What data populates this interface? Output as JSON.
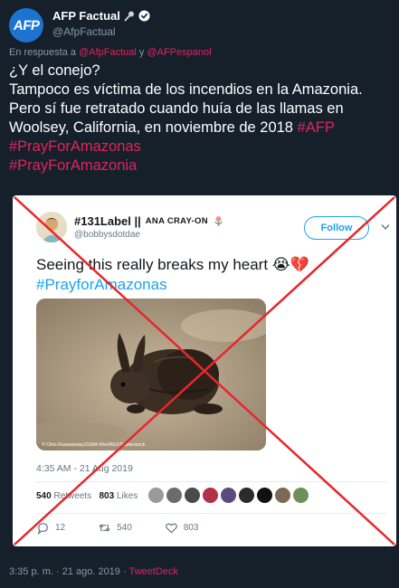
{
  "tweet": {
    "author": {
      "display_name": "AFP Factual",
      "handle": "@AfpFactual",
      "avatar_text": "AFP",
      "avatar_color": "#1d74d0",
      "badges": [
        "microphone-icon",
        "verified-icon"
      ]
    },
    "reply": {
      "prefix": "En respuesta a",
      "mention1": "@AfpFactual",
      "joiner": "y",
      "mention2": "@AFPespanol"
    },
    "text_line1": "¿Y el conejo?",
    "text_line2": "Tampoco es víctima de los incendios en la Amazonia. Pero sí fue retratado cuando huía de las llamas en Woolsey, California, en noviembre de 2018",
    "tag_afp": "#AFP",
    "tag_pray_amazonas": "#PrayForAmazonas",
    "tag_pray_amazonia": "#PrayForAmazonia",
    "footer": {
      "time": "3:35 p. m. · 21 ago. 2019 · ",
      "via": "TweetDeck"
    }
  },
  "embedded": {
    "name": "#131Label ||",
    "name_suffix": "ANA CRAY-ON",
    "handle": "@bobbysdotdae",
    "follow_label": "Follow",
    "text": "Seeing this really breaks my heart",
    "emoji_cry": "😭",
    "emoji_heart": "💔",
    "hashtag": "#PrayforAmazonas",
    "photo_credit": "© Chris Rusanowsky/ZUMA Wire/REX/Shutterstock",
    "timestamp": "4:35 AM - 21 Aug 2019",
    "retweets_count": "540",
    "retweets_label": "Retweets",
    "likes_count": "803",
    "likes_label": "Likes",
    "actions": {
      "replies": "12",
      "retweets": "540",
      "likes": "803"
    }
  },
  "colors": {
    "background": "#15202b",
    "accent_pink": "#e0245e",
    "twitter_blue": "#1da1f2",
    "cross_red": "#e8262b"
  }
}
